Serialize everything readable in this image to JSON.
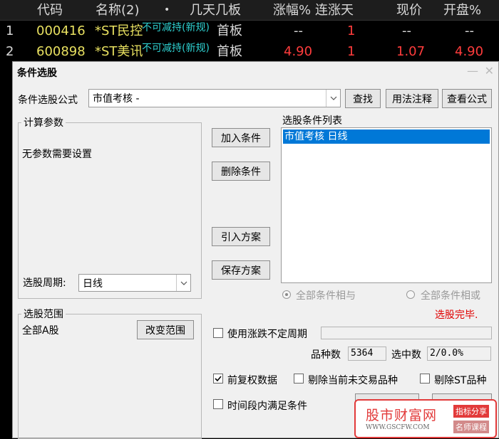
{
  "stock_table": {
    "headers": [
      "代码",
      "名称(2)",
      "•",
      "几天几板",
      "涨幅%",
      "连涨天",
      "现价",
      "开盘%"
    ],
    "rows": [
      {
        "idx": "1",
        "code": "000416",
        "name": "*ST民控",
        "tag": "不可减持(新规)",
        "board": "首板",
        "change": "--",
        "days": "1",
        "price": "--",
        "open": "--"
      },
      {
        "idx": "2",
        "code": "600898",
        "name": "*ST美讯",
        "tag": "不可减持(新规)",
        "board": "首板",
        "change": "4.90",
        "days": "1",
        "price": "1.07",
        "open": "4.90"
      }
    ]
  },
  "dialog": {
    "title": "条件选股",
    "formula_label": "条件选股公式",
    "formula_value": "市值考核  -",
    "find_button": "查找",
    "usage_button": "用法注释",
    "view_formula_button": "查看公式",
    "params_group": "计算参数",
    "params_text": "无参数需要设置",
    "period_label": "选股周期:",
    "period_value": "日线",
    "add_condition_button": "加入条件",
    "delete_condition_button": "删除条件",
    "import_plan_button": "引入方案",
    "save_plan_button": "保存方案",
    "condition_list_label": "选股条件列表",
    "condition_items": [
      "市值考核  日线"
    ],
    "radio_and_label": "全部条件相与",
    "radio_or_label": "全部条件相或",
    "status_text": "选股完毕.",
    "range_group": "选股范围",
    "range_text": "全部A股",
    "change_range_button": "改变范围",
    "use_uncertain_period_label": "使用涨跌不定周期",
    "variety_count_label": "品种数",
    "variety_count_value": "5364",
    "selected_count_label": "选中数",
    "selected_count_value": "2/0.0%",
    "prior_adjust_label": "前复权数据",
    "exclude_untraded_label": "剔除当前未交易品种",
    "exclude_st_label": "剔除ST品种",
    "time_period_label": "时间段内满足条件",
    "prior_adjust_checked": true
  },
  "watermark": {
    "text": "股市财富网",
    "url": "WWW.GSCFW.COM",
    "badge1": "指标分享",
    "badge2": "名师课程"
  },
  "colors": {
    "red": "#ff3c3c",
    "yellow": "#e8e060",
    "cyan": "#2ed0d0",
    "selection_blue": "#0078d7",
    "status_red": "#e00000"
  }
}
